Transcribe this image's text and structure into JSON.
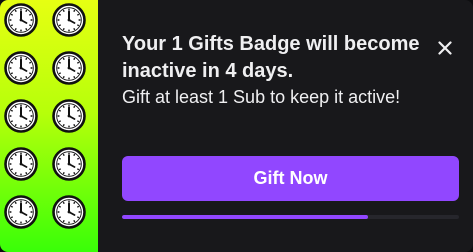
{
  "notification": {
    "title": "Your 1 Gifts Badge will become inactive in 4 days.",
    "body": "Gift at least 1 Sub to keep it active!",
    "cta_label": "Gift Now",
    "close_icon": "close-icon",
    "badge_icon": "clock-icon",
    "badge_icon_count": 10,
    "expiry_progress": 0.73
  },
  "colors": {
    "background": "#18181b",
    "text": "#efeff1",
    "accent": "#9147ff",
    "track": "#26262c",
    "badge_gradient_top": "#e6ff12",
    "badge_gradient_bottom": "#39ff08"
  }
}
